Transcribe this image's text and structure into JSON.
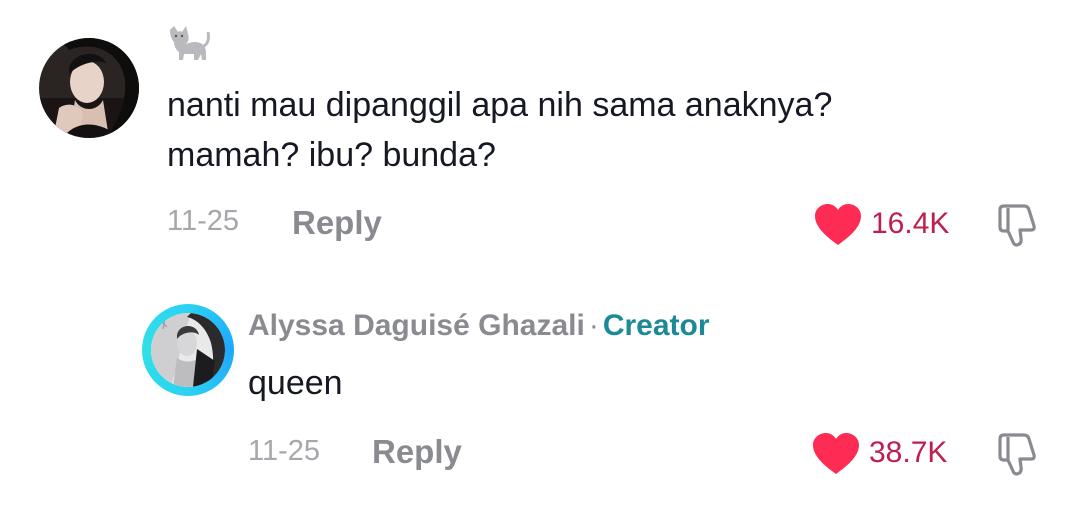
{
  "comment": {
    "username_emoji": "🐈",
    "text": "nanti mau dipanggil apa nih sama anaknya?\nmamah? ibu? bunda?",
    "date": "11-25",
    "reply_label": "Reply",
    "like_count": "16.4K",
    "liked": true,
    "like_icon": "heart-icon",
    "dislike_icon": "thumbs-down-icon"
  },
  "reply": {
    "username": "Alyssa Daguisé Ghazali",
    "separator": "·",
    "badge": "Creator",
    "text": "queen",
    "date": "11-25",
    "reply_label": "Reply",
    "like_count": "38.7K",
    "liked": true,
    "like_icon": "heart-icon",
    "dislike_icon": "thumbs-down-icon"
  },
  "colors": {
    "heart": "#fe2c55",
    "like_count": "#be1f4f",
    "creator_badge": "#1c8a96",
    "muted_text": "#8a8b91",
    "avatar_ring": "#2bd2f1"
  }
}
